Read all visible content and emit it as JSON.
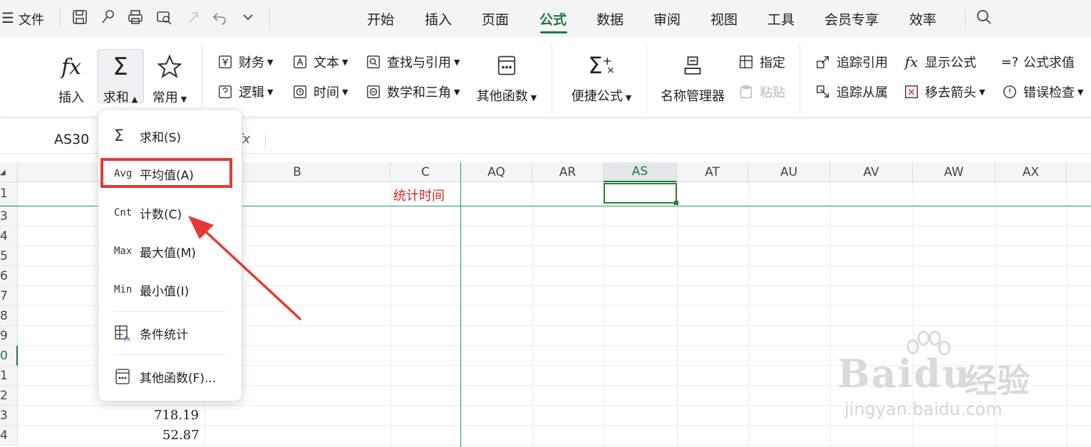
{
  "topbar": {
    "file_label": "文件",
    "tabs": [
      {
        "label": "开始"
      },
      {
        "label": "插入"
      },
      {
        "label": "页面"
      },
      {
        "label": "公式"
      },
      {
        "label": "数据"
      },
      {
        "label": "审阅"
      },
      {
        "label": "视图"
      },
      {
        "label": "工具"
      },
      {
        "label": "会员专享"
      },
      {
        "label": "效率"
      }
    ],
    "active_tab": "公式",
    "accent_color": "#1f7a3f"
  },
  "ribbon": {
    "insert_label": "插入",
    "sum_label": "求和",
    "common_label": "常用",
    "finance_label": "财务",
    "text_label": "文本",
    "lookup_label": "查找与引用",
    "other_funcs_label": "其他函数",
    "logic_label": "逻辑",
    "time_label": "时间",
    "math_label": "数学和三角",
    "quick_formula_label": "便捷公式",
    "name_manager_label": "名称管理器",
    "assign_label": "指定",
    "paste_label": "粘贴",
    "trace_precedents_label": "追踪引用",
    "show_formulas_label": "显示公式",
    "evaluate_label": "公式求值",
    "trace_dependents_label": "追踪从属",
    "remove_arrows_label": "移去箭头",
    "error_check_label": "错误检查"
  },
  "formula_bar": {
    "name_box": "AS30",
    "fx": "fx"
  },
  "dropdown": {
    "items": [
      {
        "tag": "Σ",
        "label": "求和(S)"
      },
      {
        "tag": "Avg",
        "label": "平均值(A)"
      },
      {
        "tag": "Cnt",
        "label": "计数(C)"
      },
      {
        "tag": "Max",
        "label": "最大值(M)"
      },
      {
        "tag": "Min",
        "label": "最小值(I)"
      },
      {
        "tag": "",
        "label": "条件统计"
      },
      {
        "tag": "",
        "label": "其他函数(F)..."
      }
    ],
    "highlighted_item": "平均值(A)",
    "highlight_color": "#e53935"
  },
  "sheet": {
    "columns": [
      "B",
      "C",
      "AQ",
      "AR",
      "AS",
      "AT",
      "AU",
      "AV",
      "AW",
      "AX"
    ],
    "selected_column": "AS",
    "row_headers": [
      "1",
      "3",
      "4",
      "5",
      "6",
      "7",
      "8",
      "9",
      "0",
      "1",
      "2",
      "3",
      "4"
    ],
    "title_cell": "统计时间",
    "values": [
      "718.19",
      "52.87"
    ],
    "title_color": "#d32525"
  },
  "watermark": {
    "main": "Bai",
    "du": "du",
    "cn": "经验",
    "url": "jingyan.baidu.com"
  }
}
